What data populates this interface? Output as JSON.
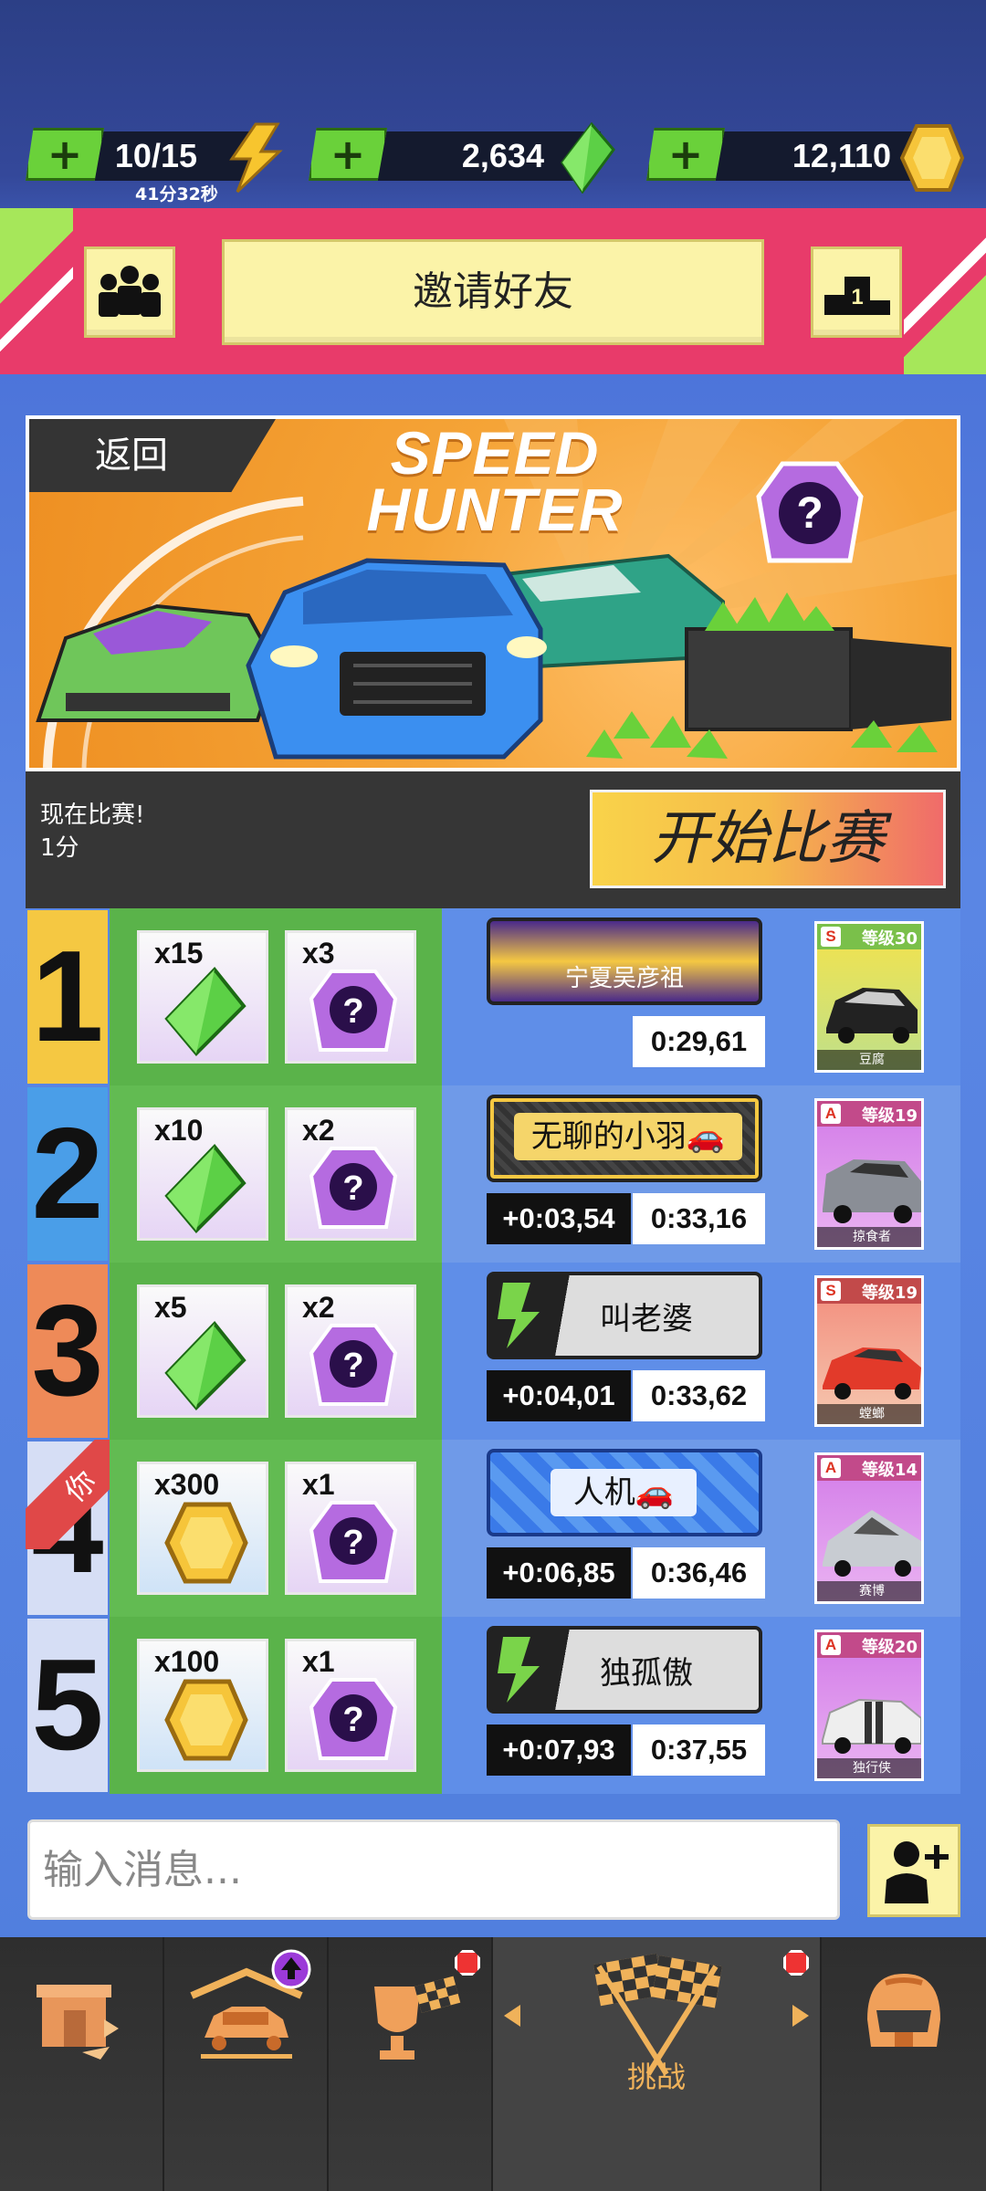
{
  "currency": {
    "energy": {
      "value": "10/15",
      "timer": "41分32秒"
    },
    "gems": {
      "value": "2,634"
    },
    "coins": {
      "value": "12,110"
    }
  },
  "header": {
    "invite_label": "邀请好友",
    "rank_number": "1"
  },
  "event": {
    "back_label": "返回",
    "title_line1": "SPEED",
    "title_line2": "HUNTER",
    "status_line1": "现在比赛!",
    "status_line2": "1分",
    "start_label": "开始比赛"
  },
  "leaderboard": [
    {
      "rank": "1",
      "reward1_qty": "x15",
      "reward1_type": "gem",
      "reward2_qty": "x3",
      "player": "宁夏吴彦祖",
      "gap": "",
      "time": "0:29,61",
      "car": {
        "class": "S",
        "level": "等级30",
        "name": "豆腐"
      },
      "rank_color": "#f5c842"
    },
    {
      "rank": "2",
      "reward1_qty": "x10",
      "reward1_type": "gem",
      "reward2_qty": "x2",
      "player": "无聊的小羽🚗",
      "gap": "+0:03,54",
      "time": "0:33,16",
      "car": {
        "class": "A",
        "level": "等级19",
        "name": "掠食者"
      },
      "rank_color": "#4a9ee8"
    },
    {
      "rank": "3",
      "reward1_qty": "x5",
      "reward1_type": "gem",
      "reward2_qty": "x2",
      "player": "叫老婆",
      "gap": "+0:04,01",
      "time": "0:33,62",
      "car": {
        "class": "S",
        "level": "等级19",
        "name": "螳螂"
      },
      "rank_color": "#ee8a58"
    },
    {
      "rank": "4",
      "reward1_qty": "x300",
      "reward1_type": "coin",
      "reward2_qty": "x1",
      "player": "人机🚗",
      "gap": "+0:06,85",
      "time": "0:36,46",
      "car": {
        "class": "A",
        "level": "等级14",
        "name": "赛博"
      },
      "rank_color": "#d6def5",
      "you": "你"
    },
    {
      "rank": "5",
      "reward1_qty": "x100",
      "reward1_type": "coin",
      "reward2_qty": "x1",
      "player": "独孤傲",
      "gap": "+0:07,93",
      "time": "0:37,55",
      "car": {
        "class": "A",
        "level": "等级20",
        "name": "独行侠"
      },
      "rank_color": "#d6def5"
    }
  ],
  "chat": {
    "placeholder": "输入消息..."
  },
  "nav": {
    "challenge_label": "挑战"
  },
  "colors": {
    "pink": "#e83b6a",
    "green": "#5ab34a",
    "yellow_btn": "#fbf3a8",
    "nav_accent": "#f0b25a"
  }
}
